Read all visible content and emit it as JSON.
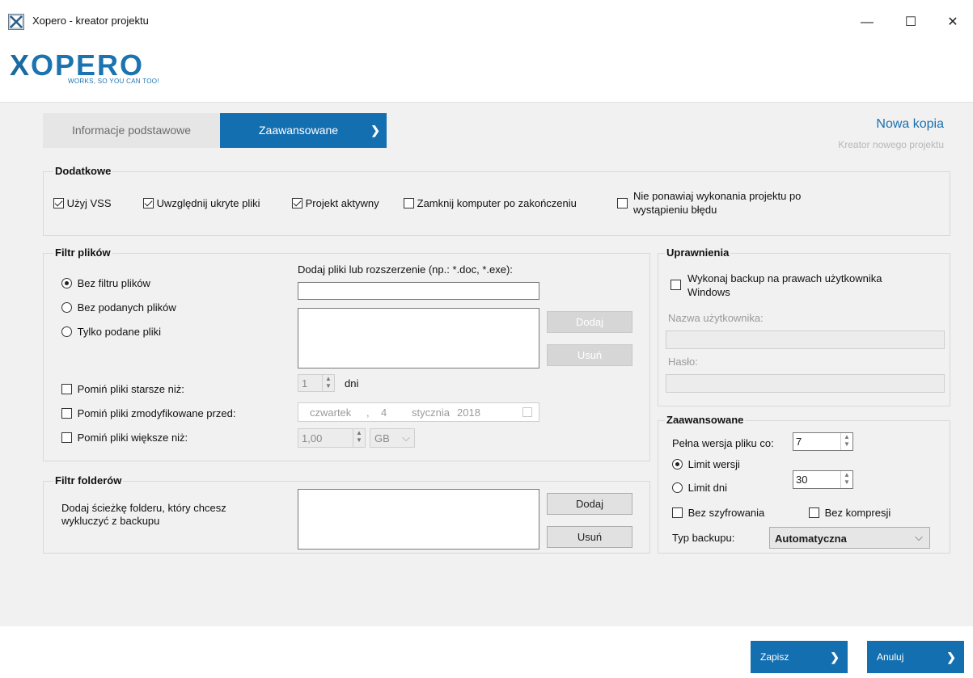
{
  "window": {
    "title": "Xopero - kreator projektu",
    "controls": {
      "minimize": "—",
      "maximize": "☐",
      "close": "✕"
    }
  },
  "logo": {
    "text": "OPERO",
    "letter": "X",
    "tagline": "WORKS, SO YOU CAN TOO!"
  },
  "tabs": [
    {
      "label": "Informacje podstawowe",
      "active": false
    },
    {
      "label": "Zaawansowane",
      "active": true,
      "chevron": "❯"
    }
  ],
  "header": {
    "title": "Nowa kopia",
    "subtitle": "Kreator nowego projektu"
  },
  "dodatkowe": {
    "title": "Dodatkowe",
    "options": [
      {
        "label": "Użyj VSS",
        "checked": true
      },
      {
        "label": "Uwzględnij ukryte pliki",
        "checked": true
      },
      {
        "label": "Projekt aktywny",
        "checked": true
      },
      {
        "label": "Zamknij komputer po zakończeniu",
        "checked": false
      },
      {
        "label_line1": "Nie ponawiaj wykonania projektu po",
        "label_line2": "wystąpieniu błędu",
        "checked": false
      }
    ]
  },
  "filtr_plikow": {
    "title": "Filtr plików",
    "add_label": "Dodaj pliki lub rozszerzenie (np.: *.doc, *.exe):",
    "input_value": "",
    "radios": [
      {
        "label": "Bez filtru plików",
        "checked": true
      },
      {
        "label": "Bez podanych plików",
        "checked": false
      },
      {
        "label": "Tylko podane pliki",
        "checked": false
      }
    ],
    "add_button": "Dodaj",
    "remove_button": "Usuń",
    "skip_older": {
      "label": "Pomiń pliki starsze niż:",
      "checked": false,
      "value": "1",
      "unit": "dni"
    },
    "skip_modified": {
      "label": "Pomiń pliki zmodyfikowane przed:",
      "checked": false,
      "weekday": "czwartek",
      "sep": ",",
      "day": "4",
      "month": "stycznia",
      "year": "2018"
    },
    "skip_larger": {
      "label": "Pomiń pliki większe niż:",
      "checked": false,
      "value": "1,00",
      "unit": "GB"
    }
  },
  "filtr_folderow": {
    "title": "Filtr folderów",
    "description_line1": "Dodaj ścieżkę folderu, który chcesz",
    "description_line2": "wykluczyć z backupu",
    "add_button": "Dodaj",
    "remove_button": "Usuń"
  },
  "uprawnienia": {
    "title": "Uprawnienia",
    "windows_backup_line1": "Wykonaj backup na prawach użytkownika",
    "windows_backup_line2": "Windows",
    "checked": false,
    "username_label": "Nazwa użytkownika:",
    "username_value": "",
    "password_label": "Hasło:",
    "password_value": ""
  },
  "zaawansowane": {
    "title": "Zaawansowane",
    "full_version_label": "Pełna wersja pliku co:",
    "full_version_value": "7",
    "limit_versions_label": "Limit wersji",
    "limit_versions_checked": true,
    "limit_days_label": "Limit dni",
    "limit_days_checked": false,
    "limit_value": "30",
    "no_encryption_label": "Bez szyfrowania",
    "no_encryption_checked": false,
    "no_compression_label": "Bez kompresji",
    "no_compression_checked": false,
    "backup_type_label": "Typ backupu:",
    "backup_type_value": "Automatyczna"
  },
  "footer": {
    "save": "Zapisz",
    "cancel": "Anuluj",
    "chevron": "❯"
  }
}
